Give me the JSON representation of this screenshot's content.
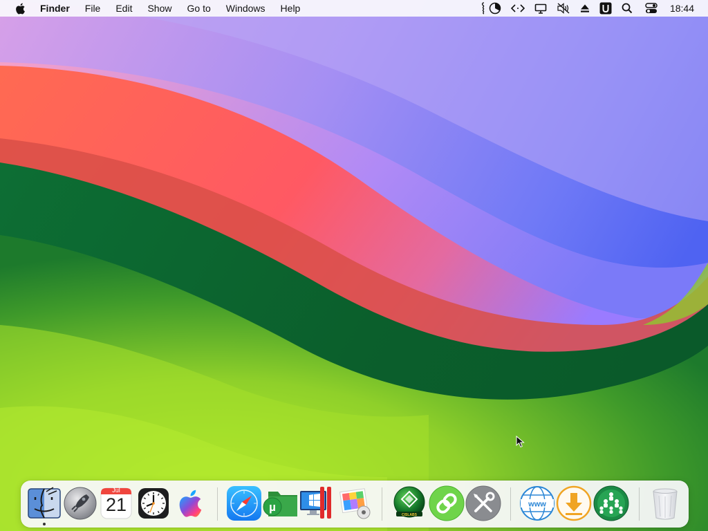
{
  "menubar": {
    "app_name": "Finder",
    "menus": [
      "File",
      "Edit",
      "Show",
      "Go to",
      "Windows",
      "Help"
    ],
    "status_icons": [
      "script-icon",
      "screen-time-icon",
      "code-brackets-icon",
      "display-icon",
      "mute-icon",
      "eject-icon",
      "u-app-icon",
      "search-icon",
      "control-center-icon"
    ],
    "clock": "18:44"
  },
  "dock": {
    "calendar": {
      "month": "Jul",
      "day": "21"
    },
    "items": [
      "Finder",
      "Launchpad",
      "Calendar",
      "Clock",
      "Apple",
      "Safari",
      "uTorrent",
      "Parallels",
      "Image Viewer",
      "Green Disc App",
      "Link App",
      "System Tools",
      "WWW",
      "Downloader",
      "Network App",
      "Trash"
    ]
  },
  "colors": {
    "menubar_bg": "#fafafc",
    "dock_bg": "#f8f8fa",
    "wallpaper_red": "#ff5a5a",
    "wallpaper_purple": "#8a78ff",
    "wallpaper_green": "#0c6a32",
    "wallpaper_lime": "#9fdd2a"
  }
}
